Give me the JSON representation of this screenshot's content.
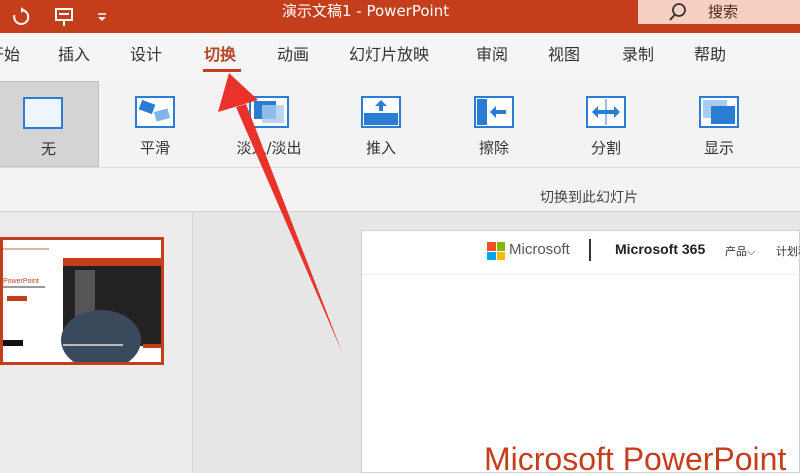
{
  "titlebar": {
    "doc_title": "演示文稿1  -  PowerPoint",
    "search_label": "搜索",
    "colors": {
      "bar": "#c43e1c",
      "search_bg": "#f7d0c3"
    }
  },
  "tabs": [
    {
      "label": "开始"
    },
    {
      "label": "插入"
    },
    {
      "label": "设计"
    },
    {
      "label": "切换",
      "active": true
    },
    {
      "label": "动画"
    },
    {
      "label": "幻灯片放映"
    },
    {
      "label": "审阅"
    },
    {
      "label": "视图"
    },
    {
      "label": "录制"
    },
    {
      "label": "帮助"
    }
  ],
  "ribbon": {
    "transitions": [
      {
        "label": "无",
        "icon": "none-transition-icon",
        "selected": true
      },
      {
        "label": "平滑",
        "icon": "morph-transition-icon"
      },
      {
        "label": "淡入/淡出",
        "icon": "fade-transition-icon"
      },
      {
        "label": "推入",
        "icon": "push-transition-icon"
      },
      {
        "label": "擦除",
        "icon": "wipe-transition-icon"
      },
      {
        "label": "分割",
        "icon": "split-transition-icon"
      },
      {
        "label": "显示",
        "icon": "reveal-transition-icon"
      }
    ],
    "group_label": "切换到此幻灯片"
  },
  "slide": {
    "brand": "Microsoft",
    "product": "Microsoft 365",
    "menu": [
      "产品",
      "计划和"
    ],
    "headline": "Microsoft PowerPoint",
    "thumb_text": "PowerPoint"
  },
  "colors": {
    "accent": "#c43e1c",
    "icon_blue": "#2b7cd3"
  }
}
